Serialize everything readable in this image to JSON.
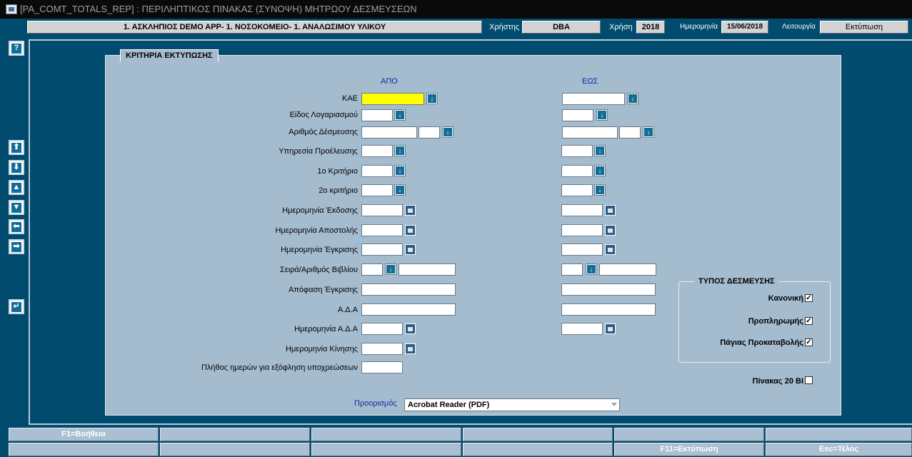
{
  "window": {
    "title": "[PA_COMT_TOTALS_REP]  :  ΠΕΡΙΛΗΠΤΙΚΟΣ ΠΙΝΑΚΑΣ (ΣΥΝΟΨΗ) ΜΗΤΡΩΟΥ ΔΕΣΜΕΥΣΕΩΝ"
  },
  "header": {
    "organization": "1. ΑΣΚΛΗΠΙΟΣ DEMO APP- 1. ΝΟΣΟΚΟΜΕΙΟ- 1. ΑΝΑΛΩΣΙΜΟΥ ΥΛΙΚΟΥ",
    "user_label": "Χρήστης",
    "user_value": "DBA",
    "year_label": "Χρήση",
    "year_value": "2018",
    "date_label": "Ημερομηνία",
    "date_value": "15/06/2018",
    "mode_label": "Λειτουργία",
    "mode_value": "Εκτύπωση"
  },
  "sidebar": {
    "help_glyph": "?",
    "nav_icons": [
      "arrow-up-icon",
      "arrow-down-icon",
      "triangle-up-icon",
      "triangle-down-icon",
      "arrow-left-icon",
      "arrow-right-icon",
      "return-icon"
    ]
  },
  "panel": {
    "title": "ΚΡΙΤΗΡΙΑ ΕΚΤΥΠΩΣΗΣ",
    "from_label": "ΑΠΟ",
    "to_label": "ΕΩΣ",
    "fields": {
      "kae": "ΚΑΕ",
      "account_type": "Είδος Λογαριασμού",
      "commitment_no": "Αριθμός Δέσμευσης",
      "origin_service": "Υπηρεσία Προέλευσης",
      "criterion1": "1ο Κριτήριο",
      "criterion2": "2ο κριτήριο",
      "issue_date": "Ημερομηνία Έκδοσης",
      "send_date": "Ημερομηνία Αποστολής",
      "approval_date": "Ημερομηνία Έγκρισης",
      "book_series": "Σειρά/Αριθμός Βιβλίου",
      "approval_decision": "Απόφαση Έγκρισης",
      "ada": "Α.Δ.Α",
      "ada_date": "Ημερομηνία Α.Δ.Α",
      "movement_date": "Ημερομηνία Κίνησης",
      "days_to_pay": "Πλήθος ημερών για εξόφληση υποχρεώσεων"
    },
    "commitment_type": {
      "title": "ΤΥΠΟΣ ΔΕΣΜΕΥΣΗΣ",
      "normal": "Κανονική",
      "prepayment": "Προπληρωμής",
      "fixed_advance": "Πάγιας Προκαταβολής",
      "normal_checked": true,
      "prepayment_checked": true,
      "fixed_advance_checked": true
    },
    "table_20bi": {
      "label": "Πίνακας 20 ΒΙ",
      "checked": false
    },
    "destination": {
      "label": "Προορισμός",
      "value": "Acrobat Reader (PDF)"
    }
  },
  "fkeys": {
    "row1": [
      "F1=Βοήθεια",
      "",
      "",
      "",
      "",
      ""
    ],
    "row2": [
      "",
      "",
      "",
      "",
      "F11=Εκτύπωση",
      "Esc=Τέλος"
    ]
  },
  "colors": {
    "background": "#004b6e",
    "panel": "#a5bccf",
    "highlight_field": "#ffff00",
    "column_header": "#0b2ba5"
  }
}
